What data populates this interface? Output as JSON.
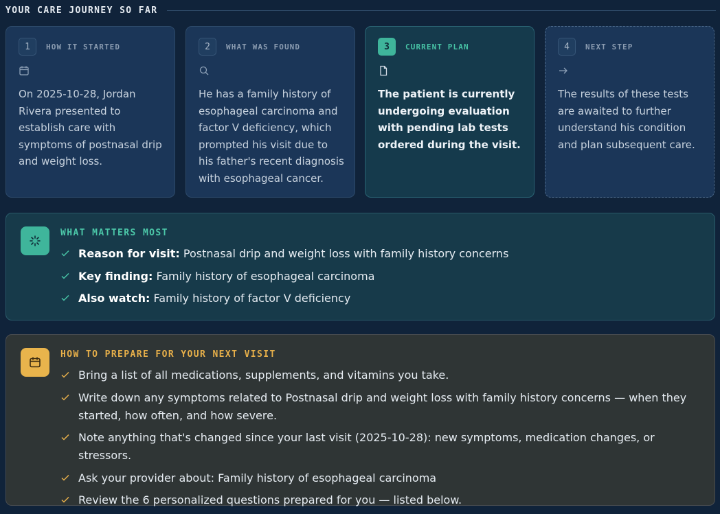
{
  "journey": {
    "title": "YOUR CARE JOURNEY SO FAR",
    "steps": [
      {
        "number": "1",
        "label": "HOW IT STARTED",
        "icon": "calendar-icon",
        "text": "On 2025-10-28, Jordan Rivera presented to establish care with symptoms of postnasal drip and weight loss."
      },
      {
        "number": "2",
        "label": "WHAT WAS FOUND",
        "icon": "search-icon",
        "text": "He has a family history of esophageal carcinoma and factor V deficiency, which prompted his visit due to his father's recent diagnosis with esophageal cancer."
      },
      {
        "number": "3",
        "label": "CURRENT PLAN",
        "icon": "document-icon",
        "text": "The patient is currently undergoing evaluation with pending lab tests ordered during the visit."
      },
      {
        "number": "4",
        "label": "NEXT STEP",
        "icon": "arrow-right-icon",
        "text": "The results of these tests are awaited to further understand his condition and plan subsequent care."
      }
    ]
  },
  "matters": {
    "title": "WHAT MATTERS MOST",
    "icon": "sparkle-icon",
    "items": [
      {
        "key": "Reason for visit:",
        "value": " Postnasal drip and weight loss with family history concerns"
      },
      {
        "key": "Key finding:",
        "value": " Family history of esophageal carcinoma"
      },
      {
        "key": "Also watch:",
        "value": " Family history of factor V deficiency"
      }
    ]
  },
  "prepare": {
    "title": "HOW TO PREPARE FOR YOUR NEXT VISIT",
    "icon": "calendar-icon",
    "items": [
      "Bring a list of all medications, supplements, and vitamins you take.",
      "Write down any symptoms related to Postnasal drip and weight loss with family history concerns — when they started, how often, and how severe.",
      "Note anything that's changed since your last visit (2025-10-28): new symptoms, medication changes, or stressors.",
      "Ask your provider about: Family history of esophageal carcinoma",
      "Review the 6 personalized questions prepared for you — listed below."
    ]
  },
  "colors": {
    "background": "#10233a",
    "teal_accent": "#3fb59b",
    "amber_accent": "#e9b44c"
  }
}
